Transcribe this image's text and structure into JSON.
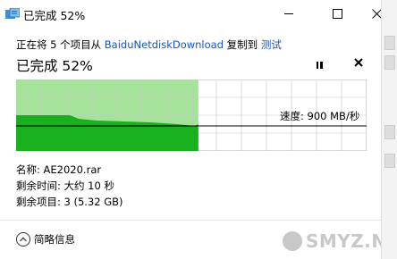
{
  "window": {
    "title": "已完成 52%"
  },
  "transfer": {
    "prefix": "正在将 5 个项目从",
    "source": "BaiduNetdiskDownload",
    "middle": "复制到",
    "destination": "测试"
  },
  "status": {
    "heading": "已完成 52%",
    "percent": 52
  },
  "speed": {
    "label": "速度: 900 MB/秒"
  },
  "details": {
    "name": "名称: AE2020.rar",
    "time_remaining": "剩余时间: 大约 10 秒",
    "items_remaining": "剩余项目: 3 (5.32 GB)"
  },
  "footer": {
    "toggle_label": "简略信息"
  },
  "watermark": {
    "text": "SMYZ.NET"
  },
  "colors": {
    "progress_light": "#a6e39a",
    "progress_dark": "#18b01e",
    "grid": "#c8c8c8",
    "link": "#1a56b8"
  }
}
